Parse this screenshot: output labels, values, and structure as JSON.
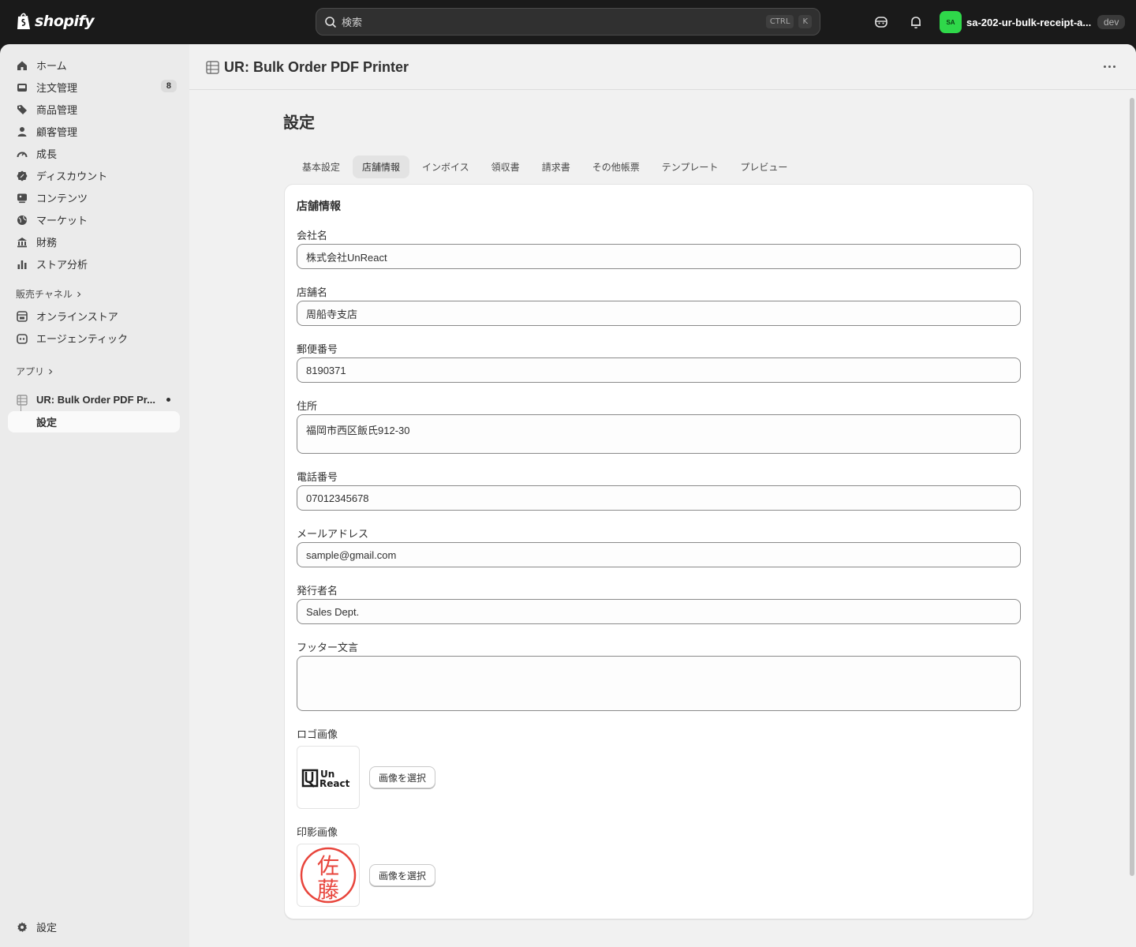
{
  "topbar": {
    "brand": "shopify",
    "search_placeholder": "検索",
    "shortcut_ctrl": "CTRL",
    "shortcut_key": "K",
    "avatar_initials": "SA",
    "store_name": "sa-202-ur-bulk-receipt-a...",
    "env_badge": "dev"
  },
  "sidebar": {
    "items": [
      {
        "label": "ホーム",
        "icon": "home-icon"
      },
      {
        "label": "注文管理",
        "icon": "inbox-icon",
        "badge": "8"
      },
      {
        "label": "商品管理",
        "icon": "tag-icon"
      },
      {
        "label": "顧客管理",
        "icon": "person-icon"
      },
      {
        "label": "成長",
        "icon": "gauge-icon"
      },
      {
        "label": "ディスカウント",
        "icon": "discount-icon"
      },
      {
        "label": "コンテンツ",
        "icon": "content-icon"
      },
      {
        "label": "マーケット",
        "icon": "globe-icon"
      },
      {
        "label": "財務",
        "icon": "bank-icon"
      },
      {
        "label": "ストア分析",
        "icon": "bar-chart-icon"
      }
    ],
    "sales_channels_heading": "販売チャネル",
    "channels": [
      {
        "label": "オンラインストア",
        "icon": "storefront-icon"
      },
      {
        "label": "エージェンティック",
        "icon": "robot-icon"
      }
    ],
    "apps_heading": "アプリ",
    "app_name": "UR: Bulk Order PDF Pr...",
    "app_sub_item": "設定",
    "settings_label": "設定"
  },
  "main": {
    "app_title": "UR: Bulk Order PDF Printer",
    "page_title": "設定",
    "tabs": [
      "基本設定",
      "店舗情報",
      "インボイス",
      "領収書",
      "請求書",
      "その他帳票",
      "テンプレート",
      "プレビュー"
    ],
    "active_tab": "店舗情報",
    "card_title": "店舗情報",
    "fields": {
      "company": {
        "label": "会社名",
        "value": "株式会社UnReact"
      },
      "store": {
        "label": "店舗名",
        "value": "周船寺支店"
      },
      "postal": {
        "label": "郵便番号",
        "value": "8190371"
      },
      "address": {
        "label": "住所",
        "value": "福岡市西区飯氏912-30"
      },
      "phone": {
        "label": "電話番号",
        "value": "07012345678"
      },
      "email": {
        "label": "メールアドレス",
        "value": "sample@gmail.com"
      },
      "issuer": {
        "label": "発行者名",
        "value": "Sales Dept."
      },
      "footer": {
        "label": "フッター文言",
        "value": ""
      }
    },
    "logo_label": "ロゴ画像",
    "logo_text_line1": "Un",
    "logo_text_line2": "React",
    "stamp_label": "印影画像",
    "stamp_text_1": "佐",
    "stamp_text_2": "藤",
    "pick_image_button": "画像を選択"
  },
  "colors": {
    "topbar_bg": "#1a1a1a",
    "sidebar_bg": "#ebebeb",
    "main_bg": "#f1f1f1",
    "avatar_bg": "#2fd84a",
    "stamp_red": "#e8453c"
  }
}
